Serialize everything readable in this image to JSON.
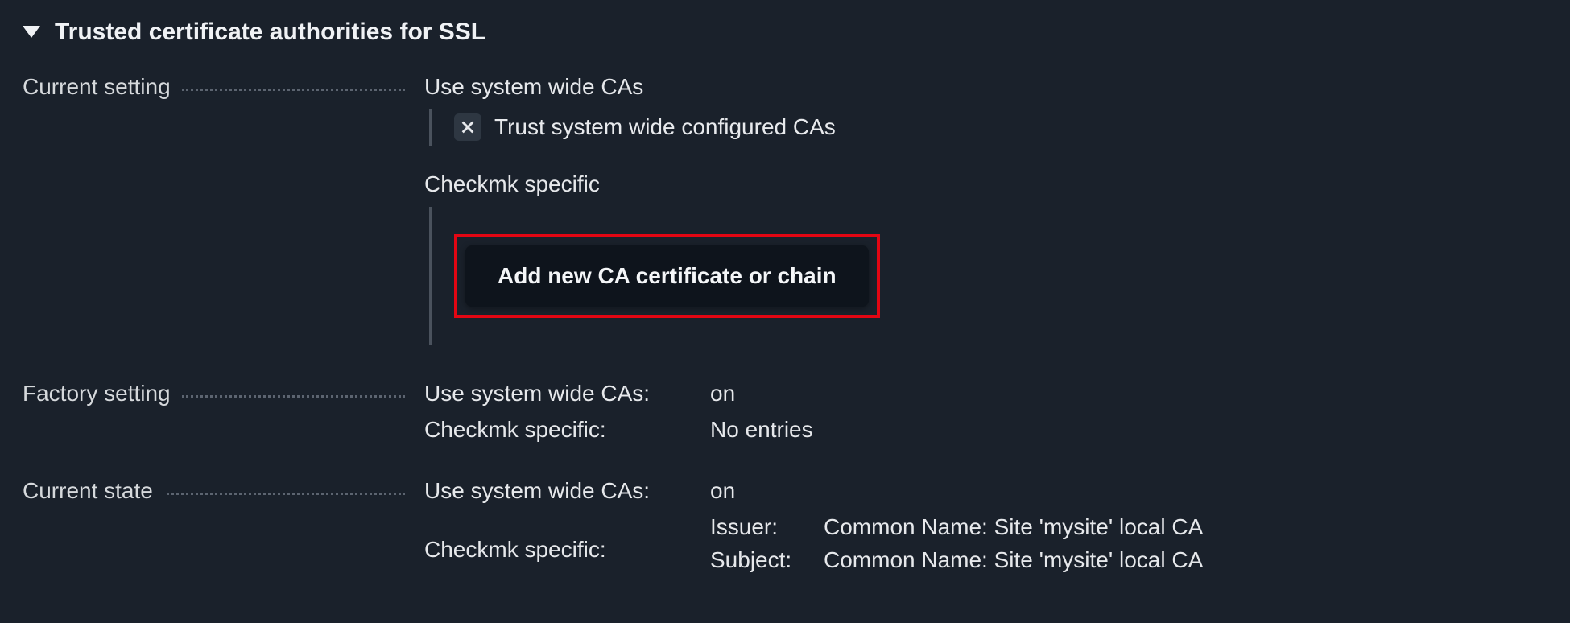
{
  "section_title": "Trusted certificate authorities for SSL",
  "labels": {
    "current_setting": "Current setting",
    "factory_setting": "Factory setting",
    "current_state": "Current state"
  },
  "current_setting": {
    "group1_title": "Use system wide CAs",
    "trust_system_wide_label": "Trust system wide configured CAs",
    "group2_title": "Checkmk specific",
    "add_button_label": "Add new CA certificate or chain"
  },
  "factory_setting": {
    "rows": [
      {
        "key": "Use system wide CAs:",
        "value": "on"
      },
      {
        "key": "Checkmk specific:",
        "value": "No entries"
      }
    ]
  },
  "current_state": {
    "use_system_wide_key": "Use system wide CAs:",
    "use_system_wide_value": "on",
    "checkmk_specific_key": "Checkmk specific:",
    "cert": {
      "issuer_label": "Issuer:",
      "issuer_value": "Common Name: Site 'mysite' local CA",
      "subject_label": "Subject:",
      "subject_value": "Common Name: Site 'mysite' local CA"
    }
  }
}
